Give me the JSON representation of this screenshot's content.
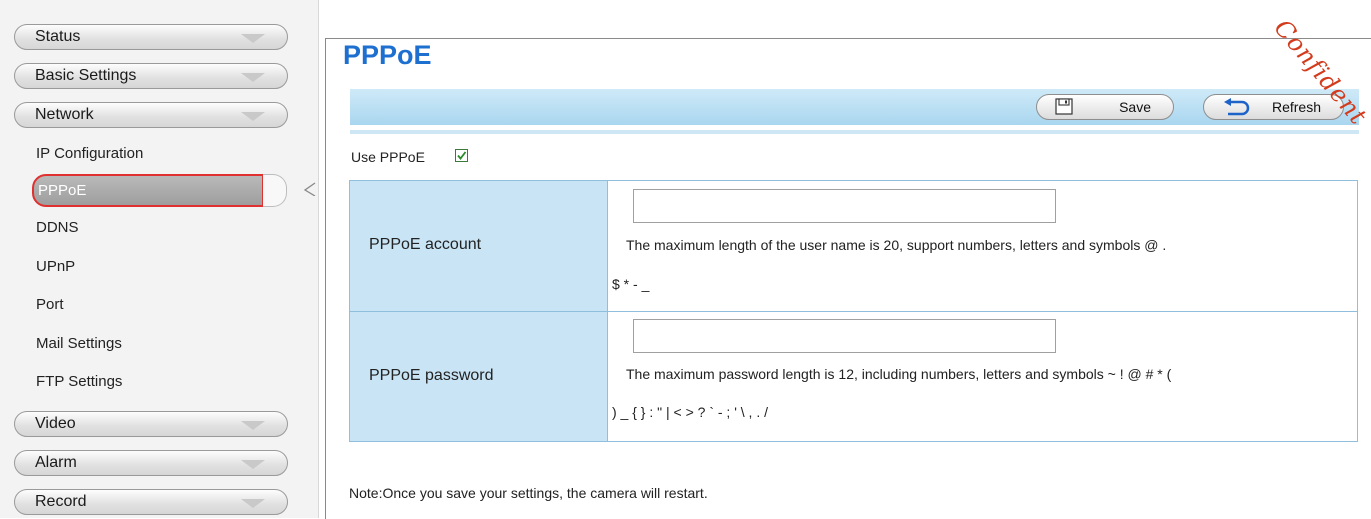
{
  "sidebar": {
    "top_items": [
      {
        "label": "Status"
      },
      {
        "label": "Basic Settings"
      },
      {
        "label": "Network"
      }
    ],
    "network_sub_items": [
      {
        "label": "IP Configuration"
      },
      {
        "label": "PPPoE"
      },
      {
        "label": "DDNS"
      },
      {
        "label": "UPnP"
      },
      {
        "label": "Port"
      },
      {
        "label": "Mail Settings"
      },
      {
        "label": "FTP Settings"
      }
    ],
    "bottom_items": [
      {
        "label": "Video"
      },
      {
        "label": "Alarm"
      },
      {
        "label": "Record"
      }
    ],
    "selected": "PPPoE"
  },
  "main": {
    "title": "PPPoE",
    "toolbar": {
      "save_label": "Save",
      "refresh_label": "Refresh"
    },
    "use_pppoe": {
      "label": "Use PPPoE",
      "checked": true
    },
    "rows": [
      {
        "label": "PPPoE account",
        "value": "",
        "hint_line1": "The maximum length of the user name is 20, support numbers, letters and symbols @ .",
        "hint_line2": "$ * - _"
      },
      {
        "label": "PPPoE password",
        "value": "",
        "hint_line1": "The maximum password length is 12, including numbers, letters and symbols ~ ! @ # * (",
        "hint_line2": ") _ { } : \" | < > ? ` - ; ' \\ , . /"
      }
    ],
    "note": "Note:Once you save your settings, the camera will restart."
  },
  "watermark": "Confident",
  "colors": {
    "title_blue": "#1d6fd0",
    "highlight_red": "#e03030",
    "toolbar_blue": "#a9d6ef",
    "label_cell_blue": "#c9e4f5"
  }
}
